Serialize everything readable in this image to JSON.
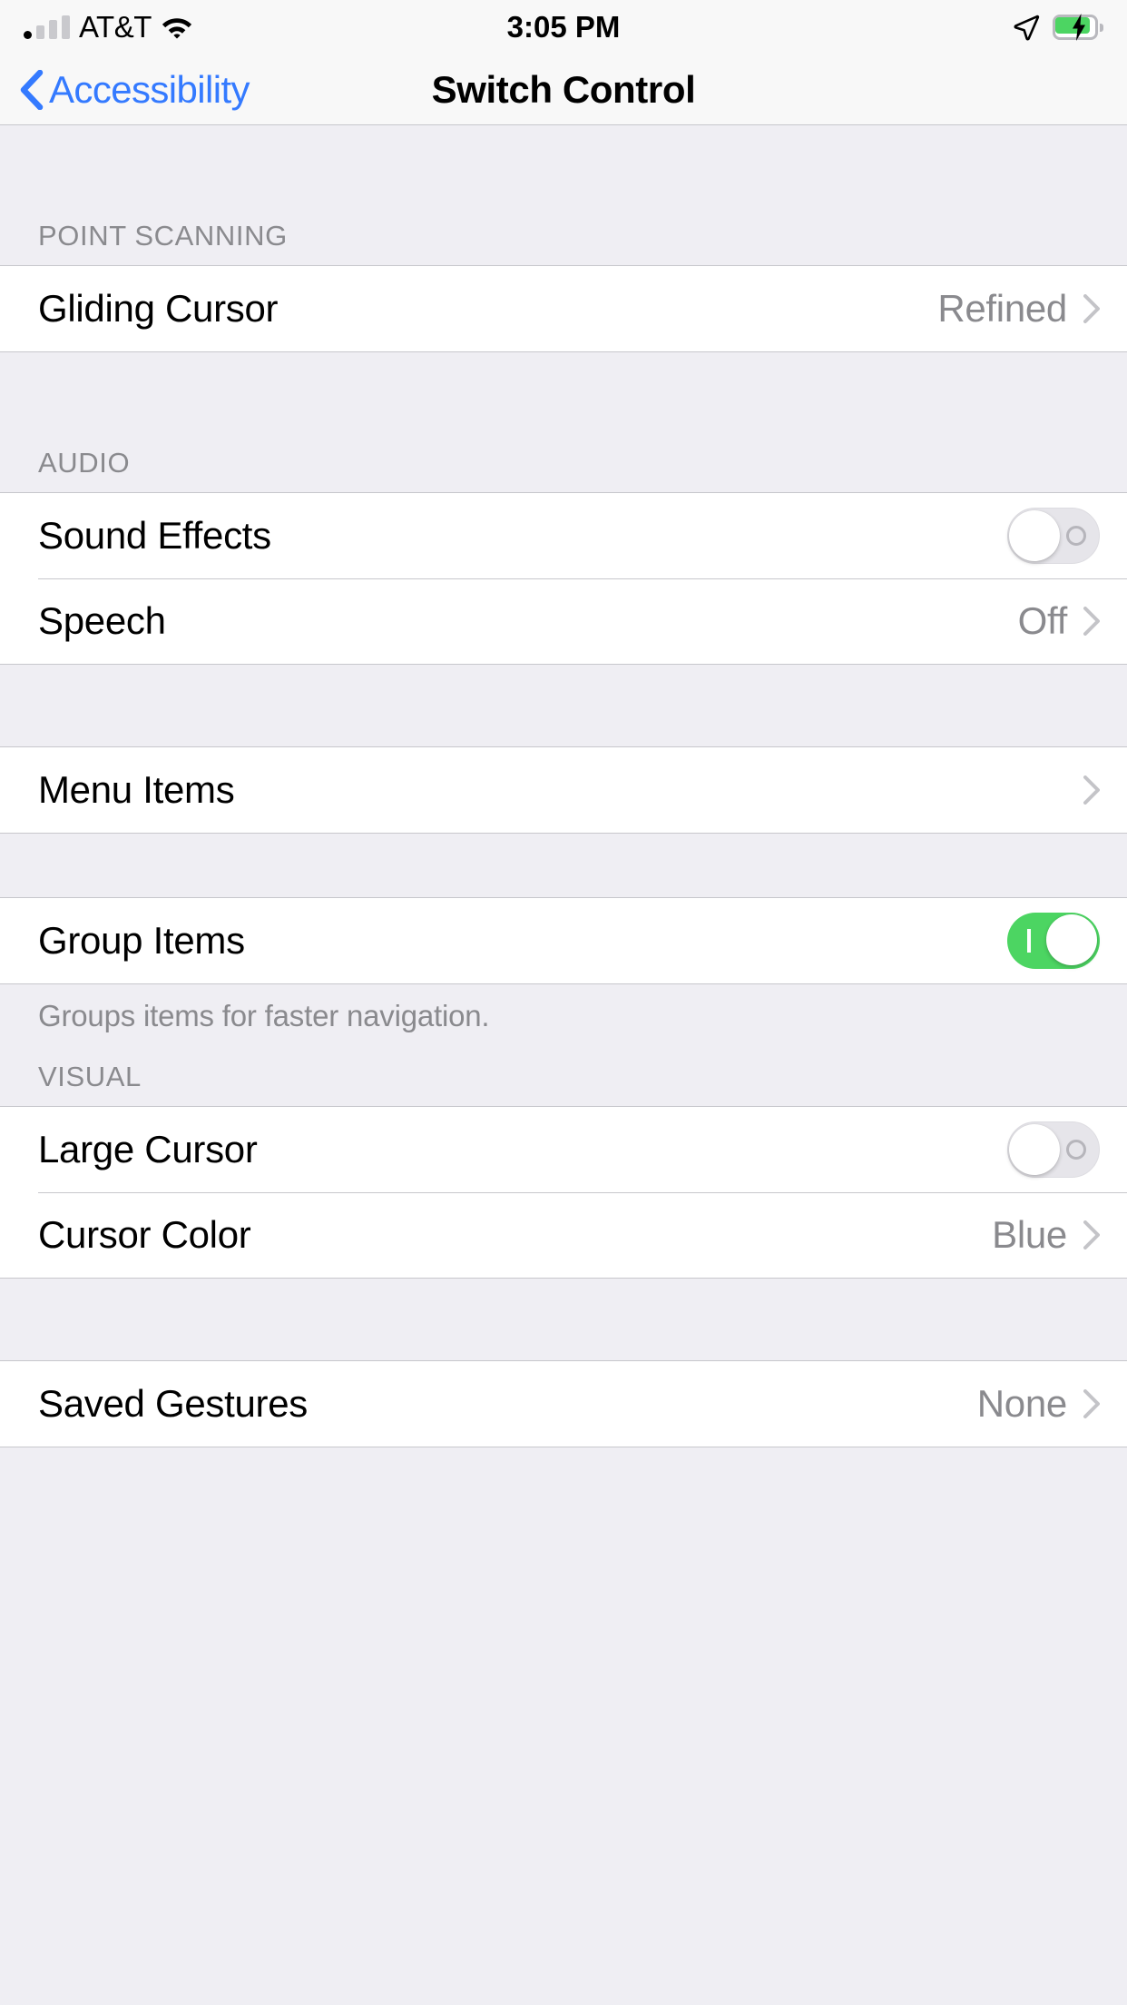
{
  "status_bar": {
    "carrier": "AT&T",
    "time": "3:05 PM",
    "signal_bars_filled": 1,
    "signal_bars_total": 4,
    "wifi_icon": "wifi-icon",
    "location_icon": "location-arrow-icon",
    "battery_icon": "battery-charging-icon",
    "battery_color": "#4cd562"
  },
  "nav": {
    "back_label": "Accessibility",
    "title": "Switch Control",
    "accent_color": "#347aff"
  },
  "sections": [
    {
      "header": "POINT SCANNING",
      "rows": [
        {
          "label": "Gliding Cursor",
          "value": "Refined",
          "type": "disclosure"
        }
      ]
    },
    {
      "header": "AUDIO",
      "rows": [
        {
          "label": "Sound Effects",
          "value": "",
          "type": "switch",
          "switch_on": false
        },
        {
          "label": "Speech",
          "value": "Off",
          "type": "disclosure"
        }
      ]
    },
    {
      "header": "",
      "rows": [
        {
          "label": "Menu Items",
          "value": "",
          "type": "disclosure"
        }
      ]
    },
    {
      "header": "",
      "rows": [
        {
          "label": "Group Items",
          "value": "",
          "type": "switch",
          "switch_on": true
        }
      ],
      "footnote": "Groups items for faster navigation."
    },
    {
      "header": "VISUAL",
      "rows": [
        {
          "label": "Large Cursor",
          "value": "",
          "type": "switch",
          "switch_on": false
        },
        {
          "label": "Cursor Color",
          "value": "Blue",
          "type": "disclosure"
        }
      ]
    },
    {
      "header": "",
      "rows": [
        {
          "label": "Saved Gestures",
          "value": "None",
          "type": "disclosure"
        }
      ]
    }
  ],
  "colors": {
    "section_background": "#efeef3",
    "row_background": "#ffffff",
    "separator": "#c7c7cc",
    "secondary_text": "#8a8a8e",
    "switch_on": "#4cd562",
    "switch_off": "#e6e5ea"
  }
}
